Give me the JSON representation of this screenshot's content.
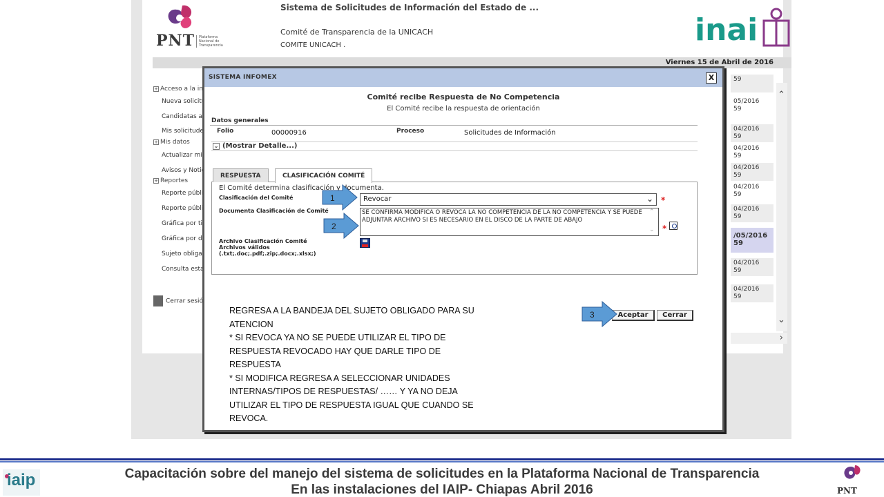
{
  "header": {
    "logo_text": "PNT",
    "logo_sub": "Plataforma Nacional de Transparencia",
    "title": "Sistema de Solicitudes de Información del Estado de ...",
    "committee": "Comité de Transparencia de la UNICACH",
    "committee_code": "COMITE UNICACH .",
    "inai_logo": "inai",
    "date": "Viernes 15 de Abril de 2016"
  },
  "sidebar": {
    "items": [
      {
        "label": "Acceso a la infor",
        "section": true
      },
      {
        "label": "Nueva solicitud"
      },
      {
        "label": "Candidatas a re"
      },
      {
        "label": "Mis solicitudes"
      },
      {
        "label": "Mis datos",
        "section": true
      },
      {
        "label": "Actualizar mis d"
      },
      {
        "label": "Avisos y Noticia"
      },
      {
        "label": "Reportes",
        "section": true
      },
      {
        "label": "Reporte público"
      },
      {
        "label": "Reporte público"
      },
      {
        "label": "Gráfica por tipo"
      },
      {
        "label": "Gráfica por depe"
      },
      {
        "label": "Sujeto obligado"
      },
      {
        "label": "Consulta estadís"
      }
    ],
    "logout": "Cerrar sesión"
  },
  "background_list": {
    "items": [
      {
        "l1": "",
        "l2": "59"
      },
      {
        "l1": "05/2016",
        "l2": "59"
      },
      {
        "l1": "04/2016",
        "l2": "59"
      },
      {
        "l1": "04/2016",
        "l2": "59"
      },
      {
        "l1": "04/2016",
        "l2": "59"
      },
      {
        "l1": "04/2016",
        "l2": "59"
      },
      {
        "l1": "04/2016",
        "l2": "59"
      },
      {
        "l1": "/05/2016",
        "l2": "59"
      },
      {
        "l1": "04/2016",
        "l2": "59"
      },
      {
        "l1": "04/2016",
        "l2": "59"
      }
    ]
  },
  "modal": {
    "title": "SISTEMA INFOMEX",
    "close": "X",
    "heading": "Comité recibe Respuesta de No Competencia",
    "subheading": "El Comité recibe la respuesta de orientación",
    "section_label": "Datos generales",
    "folio_label": "Folio",
    "folio_value": "00000916",
    "proceso_label": "Proceso",
    "proceso_value": "Solicitudes de Información",
    "show_detail": "(Mostrar Detalle...)",
    "tabs": [
      "RESPUESTA",
      "CLASIFICACIÓN COMITÉ"
    ],
    "intro": "El Comité determina clasificación y documenta.",
    "clasificacion_label": "Clasificación del Comité",
    "clasificacion_value": "Revocar",
    "documenta_label": "Documenta Clasificación de Comité",
    "documenta_value": "SE CONFIRMA MODIFICA O REVOCA  LA NO COMPETENCIA DE LA NO COMPETENCIA Y SE PUEDE ADJUNTAR ARCHIVO SI ES NECESARIO EN EL DISCO DE LA PARTE DE ABAJO",
    "archivo_label": "Archivo Clasificación Comité",
    "validos_label": "Archivos válidos",
    "validos_ext": "(.txt;.doc;.pdf;.zip;.docx;.xlsx;)",
    "required": "*",
    "accept": "Aceptar",
    "cancel": "Cerrar"
  },
  "callouts": [
    "1",
    "2",
    "3"
  ],
  "note": {
    "lines": [
      "REGRESA A LA BANDEJA DEL SUJETO OBLIGADO PARA SU",
      "ATENCION",
      "* SI REVOCA YA NO SE PUEDE UTILIZAR EL TIPO DE",
      "RESPUESTA REVOCADO HAY  QUE DARLE TIPO DE",
      "RESPUESTA",
      "* SI MODIFICA  REGRESA A SELECCIONAR UNIDADES",
      "INTERNAS/TIPOS DE RESPUESTAS/ …… Y YA NO DEJA",
      "UTILIZAR EL TIPO DE RESPUESTA IGUAL QUE CUANDO SE",
      "REVOCA."
    ]
  },
  "footer": {
    "line1": "Capacitación sobre del manejo del sistema de solicitudes en la Plataforma Nacional de Transparencia",
    "line2": "En las instalaciones del IAIP- Chiapas    Abril 2016",
    "left_logo": "iaip",
    "right_logo": "PNT"
  },
  "colors": {
    "modal_bar": "#b7c8e4",
    "arrow": "#5b9bd5",
    "footer_line": "#1a2a8a",
    "required": "#dd2222"
  }
}
